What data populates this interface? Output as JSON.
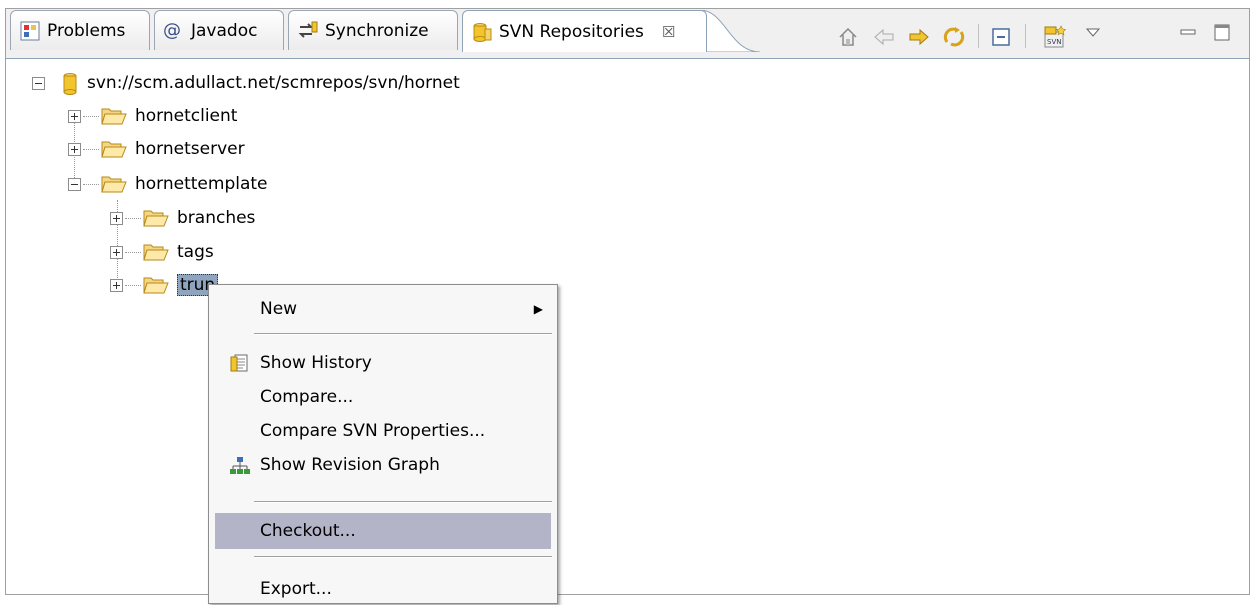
{
  "tabs": [
    {
      "label": "Problems",
      "icon": "problems-icon",
      "active": false
    },
    {
      "label": "Javadoc",
      "icon": "javadoc-icon",
      "active": false
    },
    {
      "label": "Synchronize",
      "icon": "synchronize-icon",
      "active": false
    },
    {
      "label": "SVN Repositories",
      "icon": "svn-repositories-icon",
      "active": true,
      "close": "☒"
    }
  ],
  "toolbar": {
    "buttons": [
      "home-icon",
      "back-icon",
      "forward-icon",
      "refresh-icon",
      "collapse-all-icon",
      "new-repository-location-icon",
      "view-menu-icon",
      "minimize-icon",
      "maximize-icon"
    ]
  },
  "tree": {
    "root": "svn://scm.adullact.net/scmrepos/svn/hornet",
    "items": [
      {
        "label": "hornetclient"
      },
      {
        "label": "hornetserver"
      },
      {
        "label": "hornettemplate"
      },
      {
        "label": "branches"
      },
      {
        "label": "tags"
      },
      {
        "label": "trunk",
        "visible_label": "trun"
      }
    ]
  },
  "context_menu": {
    "items": [
      {
        "label": "New",
        "submenu": "▶"
      },
      {
        "label": "Show History",
        "icon": "history-icon"
      },
      {
        "label": "Compare..."
      },
      {
        "label": "Compare SVN Properties..."
      },
      {
        "label": "Show Revision Graph",
        "icon": "revision-graph-icon"
      },
      {
        "label": "Checkout...",
        "highlighted": true
      },
      {
        "label": "Export..."
      }
    ]
  },
  "colors": {
    "selection": "#8fa4bd",
    "menu_highlight": "#b4b4c8",
    "folder": "#f0c050",
    "arrow": "#f2c42e"
  }
}
